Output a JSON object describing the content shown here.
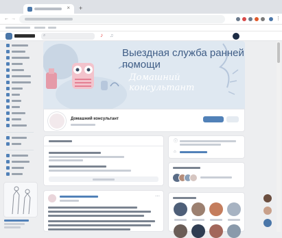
{
  "cover": {
    "title": "Выездная служба ранней помощи",
    "script_text": "Домашний консультант"
  },
  "group": {
    "name": "Домашний консультант"
  },
  "colors": {
    "vk_blue": "#4a76a8",
    "page_bg": "#edeef0",
    "cover_bg": "#dfe8f1",
    "cover_pink": "#e59aa8"
  },
  "icons": [
    "vk-logo-icon",
    "search-icon",
    "bell-icon",
    "music-icon",
    "close-icon"
  ]
}
